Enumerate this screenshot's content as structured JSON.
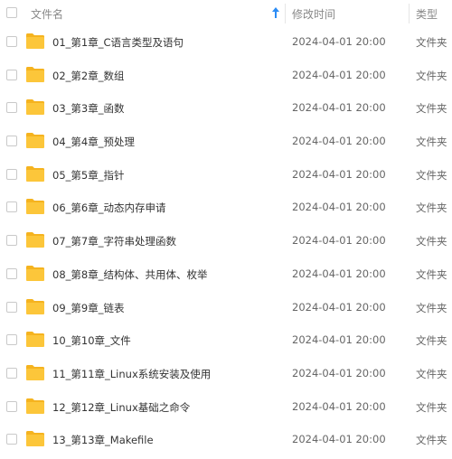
{
  "header": {
    "name_label": "文件名",
    "date_label": "修改时间",
    "type_label": "类型",
    "sort_icon": "sort-ascending-arrow-icon"
  },
  "colors": {
    "folder": "#fcc63a",
    "folder_dark": "#f5b31f",
    "sort_arrow": "#2b8cf5"
  },
  "rows": [
    {
      "name": "01_第1章_C语言类型及语句",
      "date": "2024-04-01 20:00",
      "type": "文件夹",
      "icon": "folder-icon"
    },
    {
      "name": "02_第2章_数组",
      "date": "2024-04-01 20:00",
      "type": "文件夹",
      "icon": "folder-icon"
    },
    {
      "name": "03_第3章_函数",
      "date": "2024-04-01 20:00",
      "type": "文件夹",
      "icon": "folder-icon"
    },
    {
      "name": "04_第4章_预处理",
      "date": "2024-04-01 20:00",
      "type": "文件夹",
      "icon": "folder-icon"
    },
    {
      "name": "05_第5章_指针",
      "date": "2024-04-01 20:00",
      "type": "文件夹",
      "icon": "folder-icon"
    },
    {
      "name": "06_第6章_动态内存申请",
      "date": "2024-04-01 20:00",
      "type": "文件夹",
      "icon": "folder-icon"
    },
    {
      "name": "07_第7章_字符串处理函数",
      "date": "2024-04-01 20:00",
      "type": "文件夹",
      "icon": "folder-icon"
    },
    {
      "name": "08_第8章_结构体、共用体、枚举",
      "date": "2024-04-01 20:00",
      "type": "文件夹",
      "icon": "folder-icon"
    },
    {
      "name": "09_第9章_链表",
      "date": "2024-04-01 20:00",
      "type": "文件夹",
      "icon": "folder-icon"
    },
    {
      "name": "10_第10章_文件",
      "date": "2024-04-01 20:00",
      "type": "文件夹",
      "icon": "folder-icon"
    },
    {
      "name": "11_第11章_Linux系统安装及使用",
      "date": "2024-04-01 20:00",
      "type": "文件夹",
      "icon": "folder-icon"
    },
    {
      "name": "12_第12章_Linux基础之命令",
      "date": "2024-04-01 20:00",
      "type": "文件夹",
      "icon": "folder-icon"
    },
    {
      "name": "13_第13章_Makefile",
      "date": "2024-04-01 20:00",
      "type": "文件夹",
      "icon": "folder-icon"
    }
  ]
}
